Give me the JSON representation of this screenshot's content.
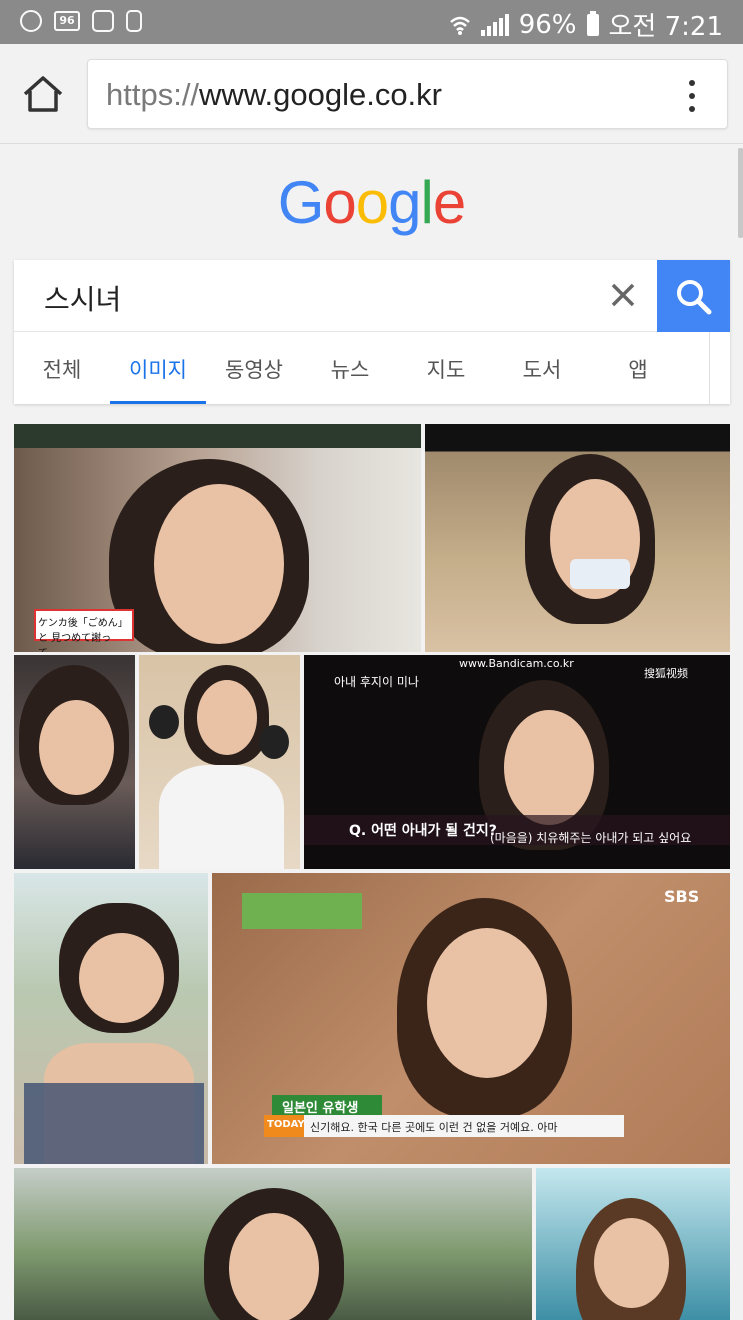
{
  "status_bar": {
    "icon_badge_text": "96",
    "battery": "96%",
    "time": "오전 7:21"
  },
  "browser": {
    "url_protocol": "https://",
    "url_host": "www.google.co.kr"
  },
  "logo": {
    "letters": [
      "G",
      "o",
      "o",
      "g",
      "l",
      "e"
    ],
    "colors": [
      "#4285f4",
      "#ea4335",
      "#fbbc05",
      "#4285f4",
      "#34a853",
      "#ea4335"
    ]
  },
  "search": {
    "query": "스시녀"
  },
  "tabs": [
    "전체",
    "이미지",
    "동영상",
    "뉴스",
    "지도",
    "도서",
    "앱"
  ],
  "active_tab": "이미지",
  "images": {
    "tv_caption_1": "ケンカ後「ごめん」と 見つめて謝って。",
    "tv_caption_2": "www.Bandicam.co.kr",
    "tv_caption_3": "아내 후지이 미나",
    "tv_caption_4": "Q. 어떤 아내가 될 건지?",
    "tv_caption_5": "(마음을) 치유해주는 아내가 되고 싶어요",
    "tv_caption_6": "SBS",
    "tv_caption_7": "일본인 유학생",
    "tv_caption_8": "신기해요. 한국 다른 곳에도 이런 건 없을 거예요. 아마",
    "tv_caption_9": "TODAY",
    "tv_caption_10": "搜狐视频"
  },
  "colors": {
    "accent": "#1a73e8",
    "search_button": "#4285f4"
  }
}
